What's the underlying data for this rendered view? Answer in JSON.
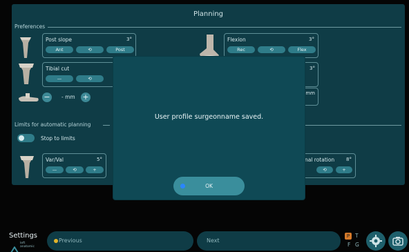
{
  "panel": {
    "title": "Planning"
  },
  "sections": {
    "preferences": "Preferences",
    "limits": "Limits for automatic planning"
  },
  "controls": {
    "post_slope": {
      "label": "Post slope",
      "value": "3°",
      "btn_left": "Ant",
      "btn_right": "Post"
    },
    "tibial_cut": {
      "label": "Tibial cut",
      "value": ""
    },
    "flexion": {
      "label": "Flexion",
      "value": "3°",
      "btn_left": "Rec",
      "btn_right": "Flex"
    },
    "right_partial": {
      "value": "3°"
    },
    "mm_stepper": {
      "text": "- mm"
    },
    "right_mm": {
      "text": "mm"
    },
    "var_val": {
      "label": "Var/Val",
      "value": "5°"
    },
    "rotation": {
      "label": "rnal rotation",
      "value": "8°"
    }
  },
  "toggle": {
    "label": "Stop to limits"
  },
  "dialog": {
    "message": "User profile surgeonname saved.",
    "ok_label": "OK"
  },
  "bottom": {
    "settings": "Settings",
    "mini_lines": [
      "left",
      "anatomic"
    ],
    "prev": "Previous",
    "next": "Next",
    "ptfg": {
      "p": "P",
      "t": "T",
      "f": "F",
      "g": "G"
    }
  },
  "colors": {
    "panel": "#0f3c46",
    "pill": "#2f7c89",
    "ok": "#3a8e9c",
    "accent_dot": "#2a86ff",
    "prev_dot": "#e2b32a",
    "p_badge": "#d57a2a"
  }
}
